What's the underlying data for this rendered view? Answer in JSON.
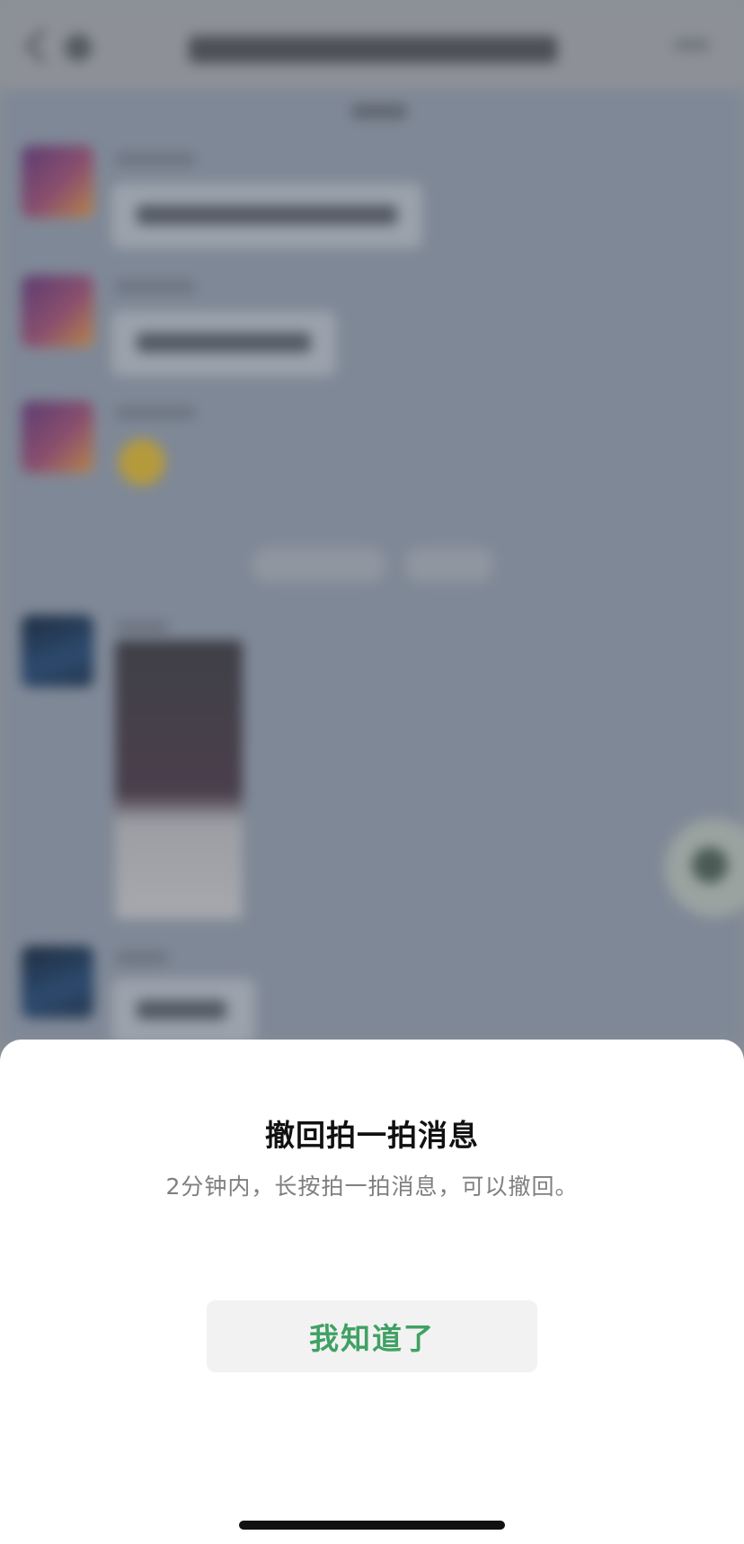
{
  "dialog": {
    "title": "撤回拍一拍消息",
    "description": "2分钟内，长按拍一拍消息，可以撤回。",
    "confirm_button": "我知道了"
  },
  "colors": {
    "accent_green": "#3fa163",
    "sheet_background": "#ffffff",
    "button_background": "#f2f2f2",
    "dimmed_backdrop": "#7f8896"
  }
}
